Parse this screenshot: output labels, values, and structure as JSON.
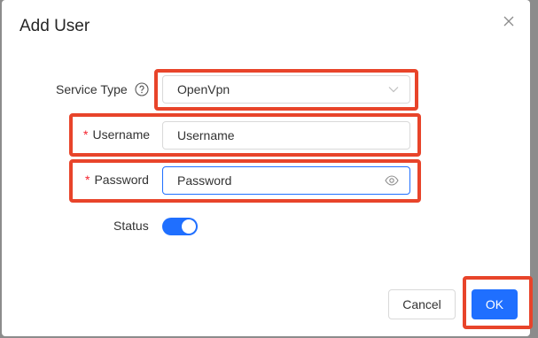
{
  "dialog": {
    "title": "Add User",
    "close_icon": "close-icon"
  },
  "form": {
    "service_type": {
      "label": "Service Type",
      "value": "OpenVpn",
      "help_icon": "question-circle-icon",
      "dropdown_icon": "chevron-down-icon"
    },
    "username": {
      "required_mark": "*",
      "label": "Username",
      "value": "Username"
    },
    "password": {
      "required_mark": "*",
      "label": "Password",
      "value": "Password",
      "visibility_icon": "eye-icon"
    },
    "status": {
      "label": "Status",
      "enabled": true
    }
  },
  "footer": {
    "cancel_label": "Cancel",
    "ok_label": "OK"
  },
  "colors": {
    "primary": "#1f6fff",
    "highlight": "#e8442a",
    "required": "#f5222d"
  }
}
